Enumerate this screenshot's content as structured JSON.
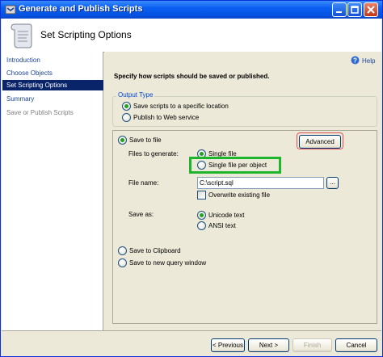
{
  "window": {
    "title": "Generate and Publish Scripts"
  },
  "header": {
    "title": "Set Scripting Options"
  },
  "sidebar": {
    "items": [
      {
        "label": "Introduction"
      },
      {
        "label": "Choose Objects"
      },
      {
        "label": "Set Scripting Options"
      },
      {
        "label": "Summary"
      },
      {
        "label": "Save or Publish Scripts"
      }
    ]
  },
  "main": {
    "help_label": "Help",
    "description": "Specify how scripts should be saved or published.",
    "output_type": {
      "legend": "Output Type",
      "option_save": "Save scripts to a specific location",
      "option_publish": "Publish to Web service"
    },
    "save_options": {
      "save_to_file": "Save to file",
      "advanced": "Advanced",
      "files_to_generate_label": "Files to generate:",
      "single_file": "Single file",
      "single_file_per_object": "Single file per object",
      "file_name_label": "File name:",
      "file_name_value": "C:\\script.sql",
      "browse": "...",
      "overwrite": "Overwrite existing file",
      "save_as_label": "Save as:",
      "unicode_text": "Unicode text",
      "ansi_text": "ANSI text",
      "save_to_clipboard": "Save to Clipboard",
      "save_to_query_window": "Save to new query window"
    }
  },
  "footer": {
    "previous": "< Previous",
    "next": "Next >",
    "finish": "Finish",
    "cancel": "Cancel"
  },
  "colors": {
    "titlebar": "#0a5ff1",
    "selected_nav": "#0a246a",
    "annotation_red": "#e0525a",
    "annotation_green": "#1cb52c"
  }
}
